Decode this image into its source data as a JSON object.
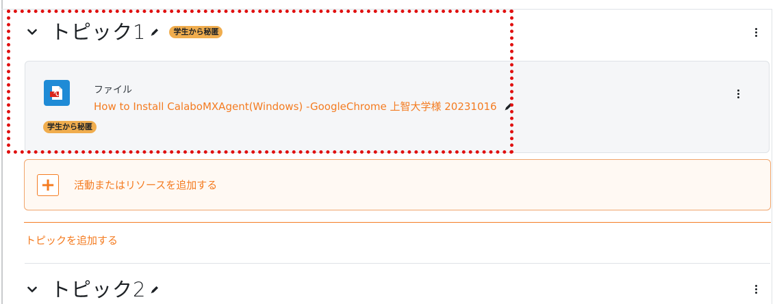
{
  "topics": [
    {
      "title": "トピック1",
      "badge": "学生から秘匿",
      "icons": {
        "toggle": "chevron-down-icon",
        "edit": "pencil-icon",
        "menu": "kebab-menu-icon"
      }
    },
    {
      "title": "トピック2",
      "icons": {
        "toggle": "chevron-down-icon",
        "edit": "pencil-icon",
        "menu": "kebab-menu-icon"
      }
    }
  ],
  "activity": {
    "type_label": "ファイル",
    "name": "How to Install CalaboMXAgent(Windows) -GoogleChrome 上智大学様 20231016",
    "badge": "学生から秘匿",
    "icon": "pdf-file-icon"
  },
  "add_activity": {
    "label": "活動またはリソースを追加する",
    "icon": "plus-icon"
  },
  "add_topic": {
    "label": "トピックを追加する"
  },
  "colors": {
    "accent": "#f47b20",
    "badge": "#f0ad4e",
    "highlight_outline": "#e01010",
    "file_icon": "#1f8bd6"
  }
}
